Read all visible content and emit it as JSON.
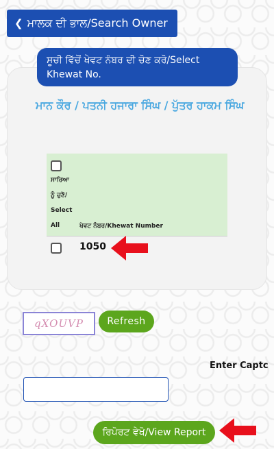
{
  "header": {
    "back_label": "ਮਾਲਕ ਦੀ ਭਾਲ/Search Owner"
  },
  "select_khewat": {
    "label": "ਸੂਚੀ ਵਿੱਚੋਂ ਖੇਵਟ ਨੰਬਰ ਦੀ ਚੋਣ ਕਰੋ/Select Khewat No."
  },
  "owner": {
    "name": "ਮਾਨ ਕੌਰ / ਪਤਨੀ ਹਜਾਰਾ ਸਿੰਘ / ਪੁੱਤਰ ਹਾਕਮ ਸਿੰਘ"
  },
  "table": {
    "select_all_lines": [
      "ਸਾਰਿਆ",
      "ਨੂੰ ਚੁਣੋ/",
      "Select",
      "All"
    ],
    "column_header": "ਖੇਵਟ ਨੰਬਰ/Khewat Number",
    "rows": [
      {
        "khewat": "1050",
        "checked": false
      }
    ]
  },
  "captcha": {
    "text": "qXOUVP",
    "refresh_label": "Refresh",
    "enter_label": "Enter Captc",
    "input_value": ""
  },
  "actions": {
    "view_report_label": "ਰਿਪੋਰਟ ਵੇਖੋ/View Report"
  },
  "colors": {
    "primary": "#1c4fb2",
    "success": "#5ca61d",
    "owner_text": "#4aa8e0",
    "annotation_arrow": "#e8101c"
  }
}
